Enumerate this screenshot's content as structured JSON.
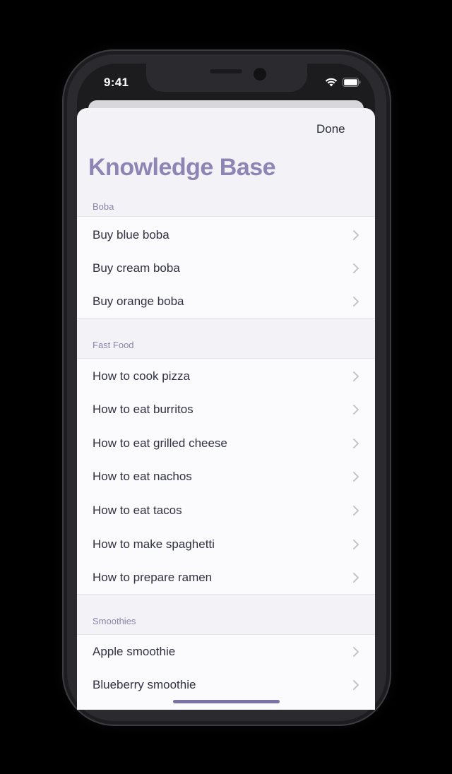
{
  "status_bar": {
    "time": "9:41",
    "wifi_icon": "wifi-icon",
    "battery_icon": "battery-icon"
  },
  "nav": {
    "done_label": "Done",
    "title": "Knowledge Base"
  },
  "colors": {
    "title": "#8f85b5",
    "section_header": "#8b84a9",
    "row_text": "#303042",
    "chevron": "#c4c4cc",
    "home_indicator": "#7a71a6"
  },
  "sections": [
    {
      "header": "Boba",
      "items": [
        "Buy blue boba",
        "Buy cream boba",
        "Buy orange boba"
      ]
    },
    {
      "header": "Fast Food",
      "items": [
        "How to cook pizza",
        "How to eat burritos",
        "How to eat grilled cheese",
        "How to eat nachos",
        "How to eat tacos",
        "How to make spaghetti",
        "How to prepare ramen"
      ]
    },
    {
      "header": "Smoothies",
      "items": [
        "Apple smoothie",
        "Blueberry smoothie"
      ]
    }
  ]
}
